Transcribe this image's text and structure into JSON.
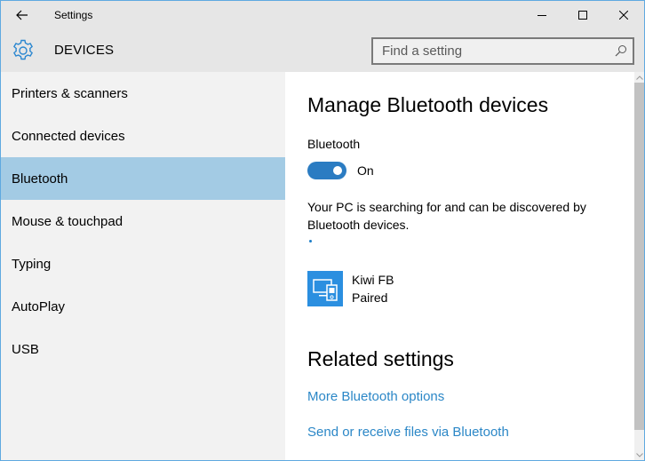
{
  "window": {
    "title": "Settings",
    "controls": {
      "minimize": "minimize",
      "maximize": "maximize",
      "close": "close"
    }
  },
  "header": {
    "section_icon": "gear-icon",
    "section_title": "DEVICES",
    "search": {
      "placeholder": "Find a setting",
      "value": ""
    }
  },
  "sidebar": {
    "items": [
      {
        "label": "Printers & scanners",
        "active": false
      },
      {
        "label": "Connected devices",
        "active": false
      },
      {
        "label": "Bluetooth",
        "active": true
      },
      {
        "label": "Mouse & touchpad",
        "active": false
      },
      {
        "label": "Typing",
        "active": false
      },
      {
        "label": "AutoPlay",
        "active": false
      },
      {
        "label": "USB",
        "active": false
      }
    ]
  },
  "main": {
    "title": "Manage Bluetooth devices",
    "bluetooth_label": "Bluetooth",
    "toggle_state": "On",
    "toggle_on": true,
    "description": "Your PC is searching for and can be discovered by Bluetooth devices.",
    "devices": [
      {
        "name": "Kiwi FB",
        "status": "Paired",
        "icon": "devices-icon"
      }
    ],
    "related_title": "Related settings",
    "related_links": [
      "More Bluetooth options",
      "Send or receive files via Bluetooth"
    ]
  },
  "colors": {
    "accent": "#2b7cc2",
    "link": "#2b87c7",
    "selected_nav": "#a3cbe4",
    "device_tile": "#2b8fe0",
    "chrome": "#e6e6e6",
    "sidebar": "#f2f2f2"
  }
}
